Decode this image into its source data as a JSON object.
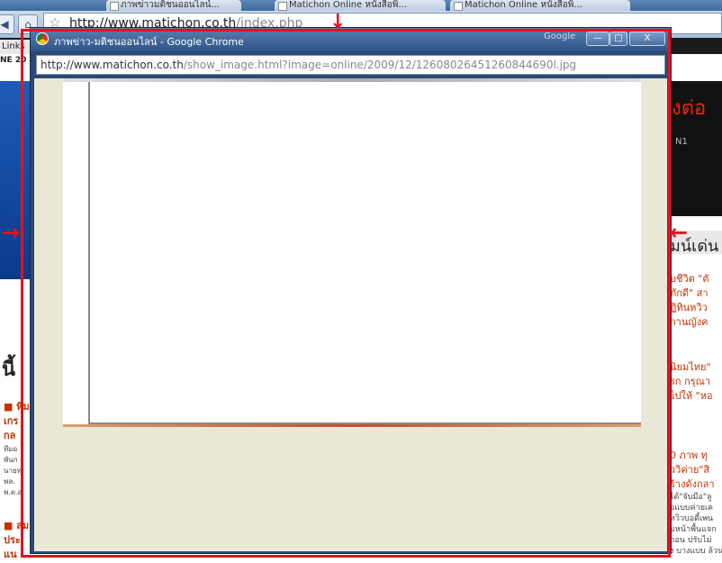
{
  "background_browser": {
    "tabs": [
      {
        "label": "ภาพข่าวมติชนออนไลน์..."
      },
      {
        "label": "Matichon Online หนังสือพิ..."
      },
      {
        "label": "Matichon Online หนังสือพิ..."
      }
    ],
    "address": {
      "host": "http://www.matichon.co.th",
      "path": "/index.php"
    },
    "bookmarks_bar": {
      "label": "Links"
    },
    "left_column": {
      "top_label": "NE 20",
      "heading": "นี้",
      "items": [
        "■ ทีม",
        "เกร",
        "กล",
        "■ สม",
        "ประ",
        "แน"
      ],
      "small_lines": [
        "ทีมอ",
        "พันก",
        "นายท",
        "พล.",
        "พ.ต.อ"
      ]
    },
    "right_column": {
      "banner_title": "งต่อ",
      "banner_sub": "N1",
      "section_header": "มน์เด่น",
      "story_lines": [
        "บชีวิต \"ตั",
        "ภักดี\" สา",
        "ฏิทินหวิว",
        "กานญังค",
        "นิยมไทย\"",
        "รก กรุณา",
        "ไปให้ \"หอ",
        "0 ภาพ ทุ",
        "ววิค่าย\"สิ",
        "ร้างดังกลา"
      ],
      "small_lines": [
        "ได้\"จับมือ\"ลู",
        "อแบบค่ายเค",
        "หวิวบอดี้เพน",
        "มหน้าพื้นแจก",
        "ถอน ปรับไม่",
        "ง บางแบบ ล้วนแ"
      ]
    }
  },
  "popup": {
    "title": "ภาพข่าว-มติชนออนไลน์ - Google Chrome",
    "brand": "Google",
    "buttons": {
      "minimize": "—",
      "maximize": "□",
      "close": "X"
    },
    "url": {
      "host": "http://www.matichon.co.th",
      "path": "/show_image.html?image=online/2009/12/12608026451260844690l.jpg"
    }
  },
  "colors": {
    "annotation_red": "#e0141e",
    "popup_frame": "#2a4a74",
    "content_bg": "#ebe8d8"
  }
}
